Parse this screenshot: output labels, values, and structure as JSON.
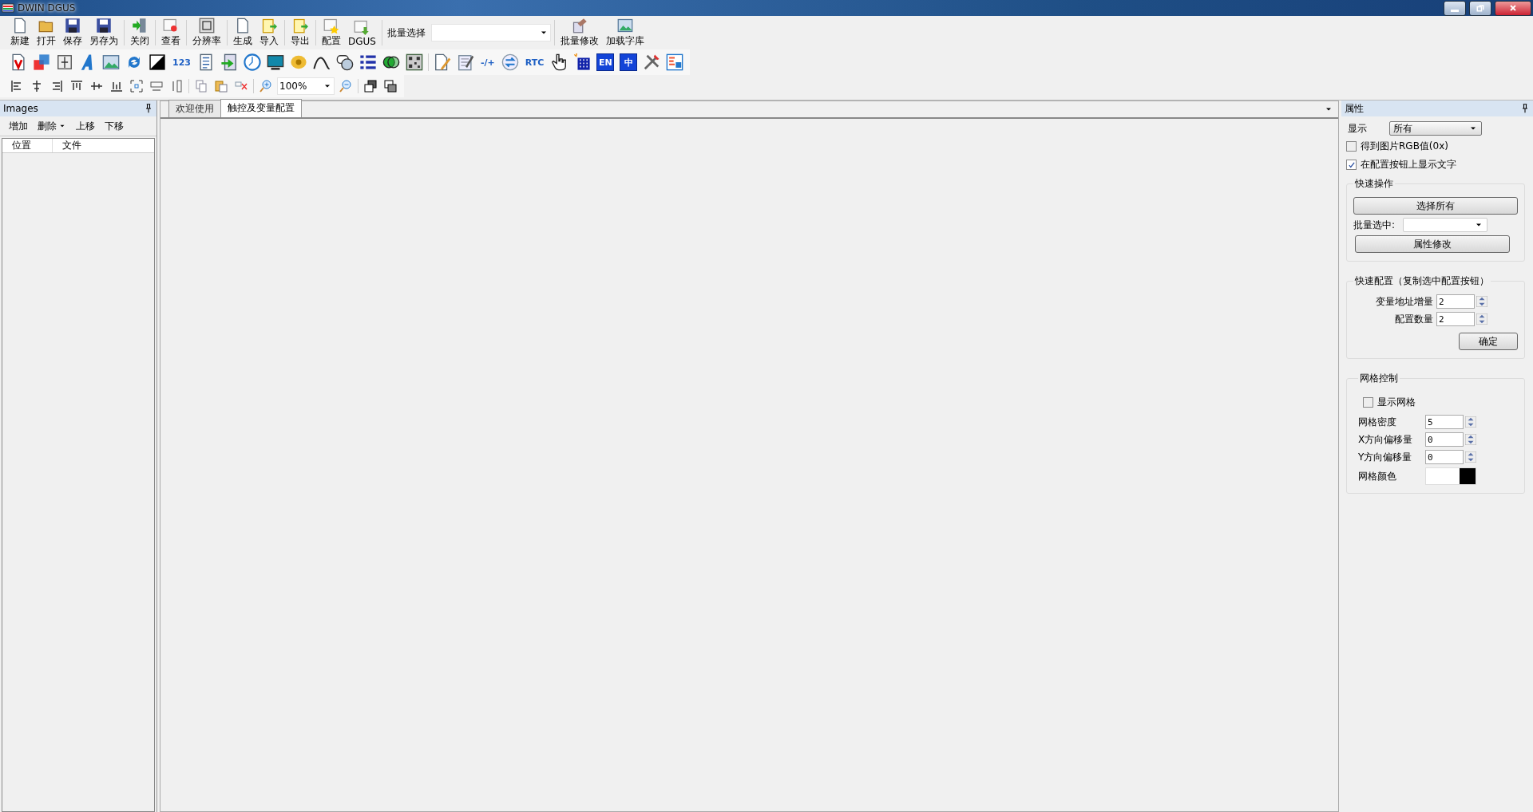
{
  "window": {
    "title": "DWIN DGUS"
  },
  "main_toolbar": {
    "groups": [
      [
        {
          "label": "新建"
        },
        {
          "label": "打开"
        },
        {
          "label": "保存"
        },
        {
          "label": "另存为"
        }
      ],
      [
        {
          "label": "关闭"
        }
      ],
      [
        {
          "label": "查看"
        }
      ],
      [
        {
          "label": "分辨率"
        }
      ],
      [
        {
          "label": "生成"
        },
        {
          "label": "导入"
        }
      ],
      [
        {
          "label": "导出"
        }
      ],
      [
        {
          "label": "配置"
        },
        {
          "label": "DGUS"
        }
      ]
    ],
    "batch_select": {
      "label": "批量选择"
    },
    "tail": [
      {
        "label": "批量修改"
      },
      {
        "label": "加载字库"
      }
    ]
  },
  "control_toolbar": {
    "groups": [
      [
        {
          "kind": "icon"
        },
        {
          "kind": "icon"
        },
        {
          "kind": "icon"
        },
        {
          "kind": "icon"
        },
        {
          "kind": "icon"
        },
        {
          "kind": "icon"
        },
        {
          "kind": "icon"
        },
        {
          "kind": "text",
          "text": "123"
        },
        {
          "kind": "icon"
        },
        {
          "kind": "icon"
        },
        {
          "kind": "icon"
        },
        {
          "kind": "icon"
        },
        {
          "kind": "icon"
        },
        {
          "kind": "icon"
        },
        {
          "kind": "icon"
        },
        {
          "kind": "icon"
        },
        {
          "kind": "icon"
        },
        {
          "kind": "icon"
        }
      ],
      [
        {
          "kind": "icon"
        },
        {
          "kind": "icon"
        },
        {
          "kind": "text",
          "text": "-/+"
        },
        {
          "kind": "icon"
        },
        {
          "kind": "text",
          "text": "RTC"
        },
        {
          "kind": "icon"
        },
        {
          "kind": "icon"
        },
        {
          "kind": "badge",
          "text": "EN"
        },
        {
          "kind": "badge",
          "text": "中"
        },
        {
          "kind": "icon"
        },
        {
          "kind": "icon"
        }
      ]
    ]
  },
  "layout_toolbar": {
    "zoom": "100%"
  },
  "images_panel": {
    "title": "Images",
    "actions": [
      {
        "label": "增加",
        "dropdown": false
      },
      {
        "label": "删除",
        "dropdown": true
      },
      {
        "label": "上移",
        "dropdown": false
      },
      {
        "label": "下移",
        "dropdown": false
      }
    ],
    "columns": [
      "位置",
      "文件"
    ]
  },
  "tabs": [
    {
      "label": "欢迎使用",
      "selected": false
    },
    {
      "label": "触控及变量配置",
      "selected": true
    }
  ],
  "properties": {
    "title": "属性",
    "display": {
      "label": "显示",
      "value": "所有"
    },
    "checkboxes": [
      {
        "label": "得到图片RGB值(0x)",
        "checked": false
      },
      {
        "label": "在配置按钮上显示文字",
        "checked": true
      }
    ],
    "quick_ops": {
      "title": "快速操作",
      "select_all": "选择所有",
      "batch_label": "批量选中:",
      "modify": "属性修改"
    },
    "quick_config": {
      "title": "快速配置（复制选中配置按钮）",
      "fields": [
        {
          "label": "变量地址增量",
          "value": "2"
        },
        {
          "label": "配置数量",
          "value": "2"
        }
      ],
      "confirm": "确定"
    },
    "grid": {
      "title": "网格控制",
      "show": {
        "label": "显示网格",
        "checked": false
      },
      "fields": [
        {
          "label": "网格密度",
          "value": "5"
        },
        {
          "label": "X方向偏移量",
          "value": "0"
        },
        {
          "label": "Y方向偏移量",
          "value": "0"
        }
      ],
      "color_label": "网格颜色",
      "color": "#000000"
    }
  }
}
